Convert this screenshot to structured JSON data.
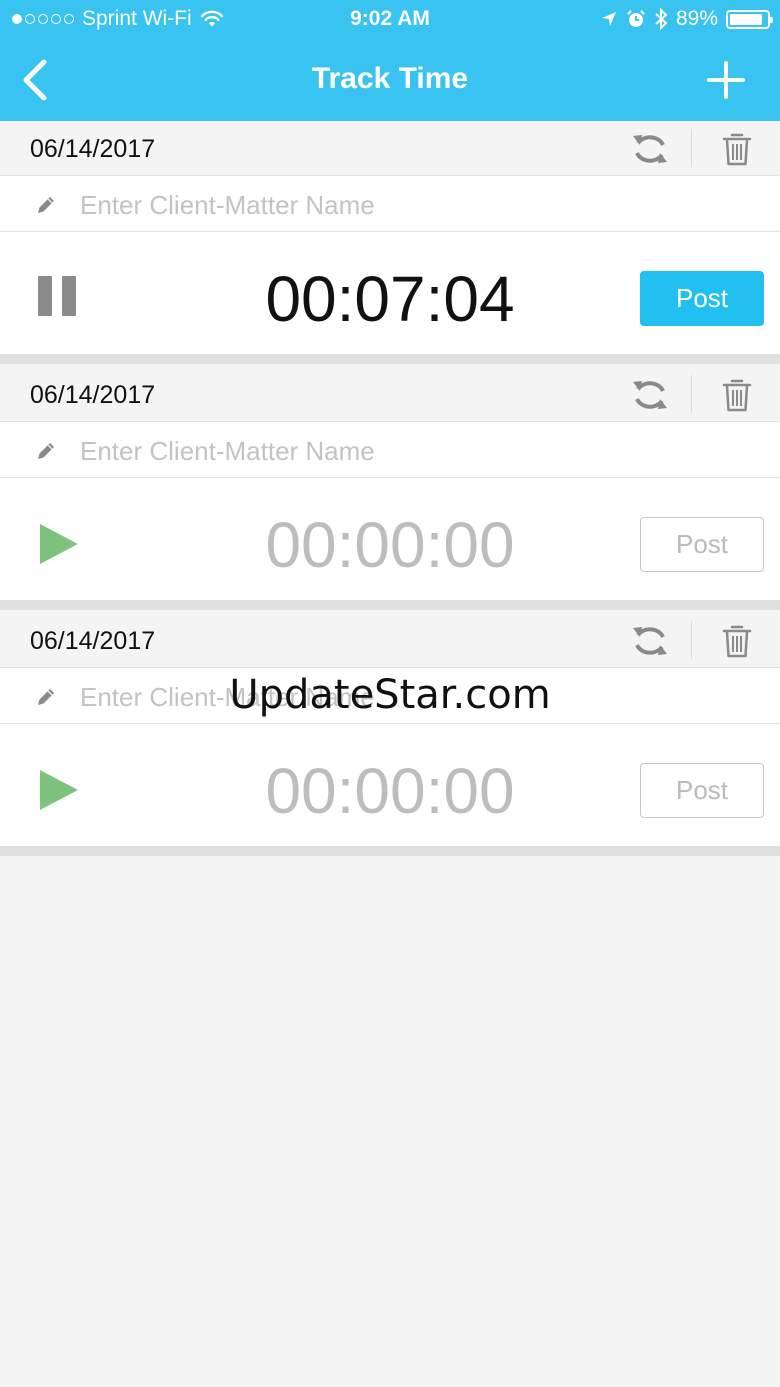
{
  "status_bar": {
    "carrier": "Sprint Wi-Fi",
    "time": "9:02 AM",
    "battery": "89%",
    "battery_level": 0.89,
    "signal_bars_filled": 1,
    "signal_bars_total": 5
  },
  "nav": {
    "title": "Track Time",
    "back_icon": "chevron-left-icon",
    "add_icon": "plus-icon"
  },
  "entries": [
    {
      "date": "06/14/2017",
      "name_placeholder": "Enter Client-Matter Name",
      "name_value": "",
      "timer": "00:07:04",
      "running": true,
      "post_label": "Post"
    },
    {
      "date": "06/14/2017",
      "name_placeholder": "Enter Client-Matter Name",
      "name_value": "",
      "timer": "00:00:00",
      "running": false,
      "post_label": "Post"
    },
    {
      "date": "06/14/2017",
      "name_placeholder": "Enter Client-Matter Name",
      "name_value": "",
      "timer": "00:00:00",
      "running": false,
      "post_label": "Post"
    }
  ],
  "watermark": "UpdateStar.com",
  "colors": {
    "header": "#39c3f0",
    "post_active": "#22c0f0",
    "play": "#7ec37d",
    "pause": "#8a8a8a",
    "icon_gray": "#8a8a8a"
  }
}
